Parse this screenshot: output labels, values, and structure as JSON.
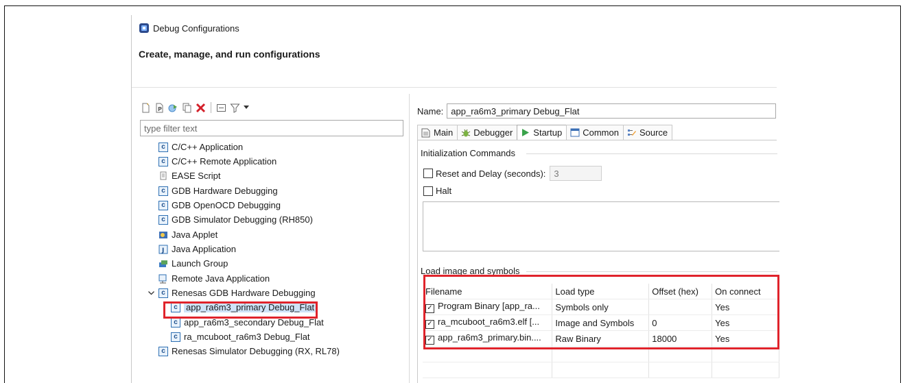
{
  "window": {
    "title": "Debug Configurations",
    "header": "Create, manage, and run configurations"
  },
  "left_panel": {
    "filter_placeholder": "type filter text",
    "tree": [
      {
        "label": "C/C++ Application",
        "icon": "c-config-icon"
      },
      {
        "label": "C/C++ Remote Application",
        "icon": "c-config-icon"
      },
      {
        "label": "EASE Script",
        "icon": "script-icon"
      },
      {
        "label": "GDB Hardware Debugging",
        "icon": "c-config-icon"
      },
      {
        "label": "GDB OpenOCD Debugging",
        "icon": "c-config-icon"
      },
      {
        "label": "GDB Simulator Debugging (RH850)",
        "icon": "c-config-icon"
      },
      {
        "label": "Java Applet",
        "icon": "java-applet-icon"
      },
      {
        "label": "Java Application",
        "icon": "java-app-icon"
      },
      {
        "label": "Launch Group",
        "icon": "launch-group-icon"
      },
      {
        "label": "Remote Java Application",
        "icon": "remote-java-icon"
      },
      {
        "label": "Renesas GDB Hardware Debugging",
        "icon": "c-config-icon",
        "expanded": true
      },
      {
        "label": "app_ra6m3_primary Debug_Flat",
        "icon": "c-config-icon",
        "selected": true
      },
      {
        "label": "app_ra6m3_secondary Debug_Flat",
        "icon": "c-config-icon"
      },
      {
        "label": "ra_mcuboot_ra6m3 Debug_Flat",
        "icon": "c-config-icon"
      },
      {
        "label": "Renesas Simulator Debugging (RX, RL78)",
        "icon": "c-config-icon"
      }
    ]
  },
  "right_panel": {
    "name_label": "Name:",
    "name_value": "app_ra6m3_primary Debug_Flat",
    "tabs": [
      {
        "label": "Main",
        "icon": "main-tab-icon"
      },
      {
        "label": "Debugger",
        "icon": "debugger-tab-icon"
      },
      {
        "label": "Startup",
        "icon": "startup-tab-icon",
        "active": true
      },
      {
        "label": "Common",
        "icon": "common-tab-icon"
      },
      {
        "label": "Source",
        "icon": "source-tab-icon"
      }
    ],
    "init_commands": {
      "title": "Initialization Commands",
      "reset_label": "Reset and Delay (seconds):",
      "reset_checked": false,
      "reset_value": "3",
      "halt_label": "Halt",
      "halt_checked": false
    },
    "load_image": {
      "title": "Load image and symbols",
      "columns": [
        "Filename",
        "Load type",
        "Offset (hex)",
        "On connect"
      ],
      "rows": [
        {
          "filename": "Program Binary [app_ra...",
          "load_type": "Symbols only",
          "offset": "",
          "on_connect": "Yes",
          "checked": true
        },
        {
          "filename": "ra_mcuboot_ra6m3.elf [...",
          "load_type": "Image and Symbols",
          "offset": "0",
          "on_connect": "Yes",
          "checked": true
        },
        {
          "filename": "app_ra6m3_primary.bin....",
          "load_type": "Raw Binary",
          "offset": "18000",
          "on_connect": "Yes",
          "checked": true
        }
      ]
    }
  },
  "colors": {
    "highlight_border": "#e0232b",
    "selection_bg": "#cfe3f8"
  }
}
